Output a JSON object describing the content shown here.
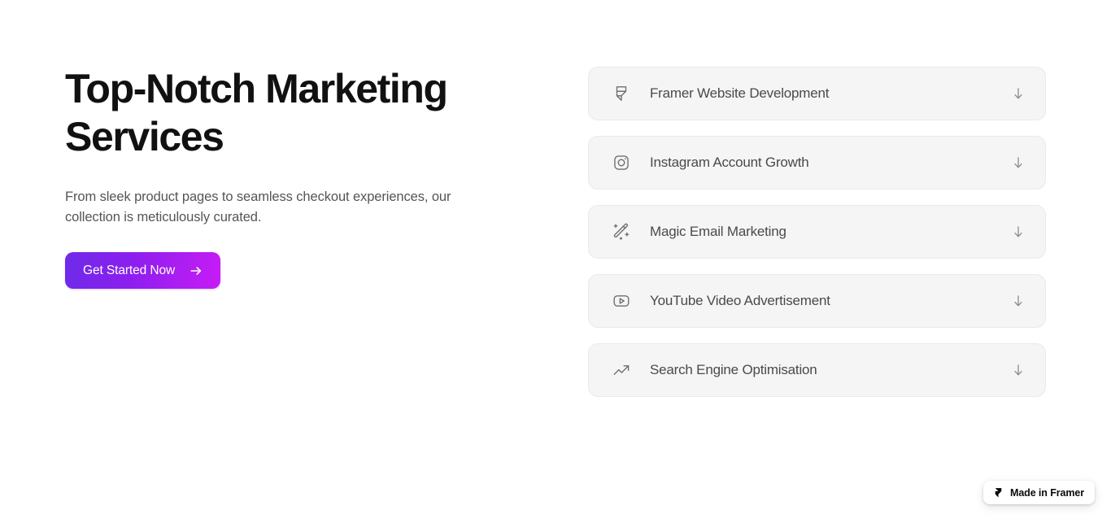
{
  "hero": {
    "title": "Top-Notch Marketing Services",
    "description": "From sleek product pages to seamless checkout experiences, our collection is meticulously curated.",
    "cta": {
      "label": "Get Started Now",
      "icon": "arrow-right-icon"
    }
  },
  "accordion": {
    "items": [
      {
        "label": "Framer Website Development",
        "icon": "framer-icon",
        "toggle_icon": "arrow-down-icon",
        "expanded": false
      },
      {
        "label": "Instagram Account Growth",
        "icon": "instagram-icon",
        "toggle_icon": "arrow-down-icon",
        "expanded": false
      },
      {
        "label": "Magic Email Marketing",
        "icon": "magic-wand-icon",
        "toggle_icon": "arrow-down-icon",
        "expanded": false
      },
      {
        "label": "YouTube Video Advertisement",
        "icon": "youtube-icon",
        "toggle_icon": "arrow-down-icon",
        "expanded": false
      },
      {
        "label": "Search Engine Optimisation",
        "icon": "trending-up-icon",
        "toggle_icon": "arrow-down-icon",
        "expanded": false
      }
    ]
  },
  "badge": {
    "label": "Made in Framer",
    "icon": "framer-logo-icon"
  },
  "colors": {
    "page_background": "#ffffff",
    "heading": "#111111",
    "body_text": "#555555",
    "row_background": "#f5f5f5",
    "row_border": "#eaeaea",
    "row_label": "#4a4a4a",
    "row_icon": "#6e6e6e",
    "cta_gradient_start": "#6e2be8",
    "cta_gradient_end": "#c81cf5",
    "cta_text": "#ffffff"
  }
}
